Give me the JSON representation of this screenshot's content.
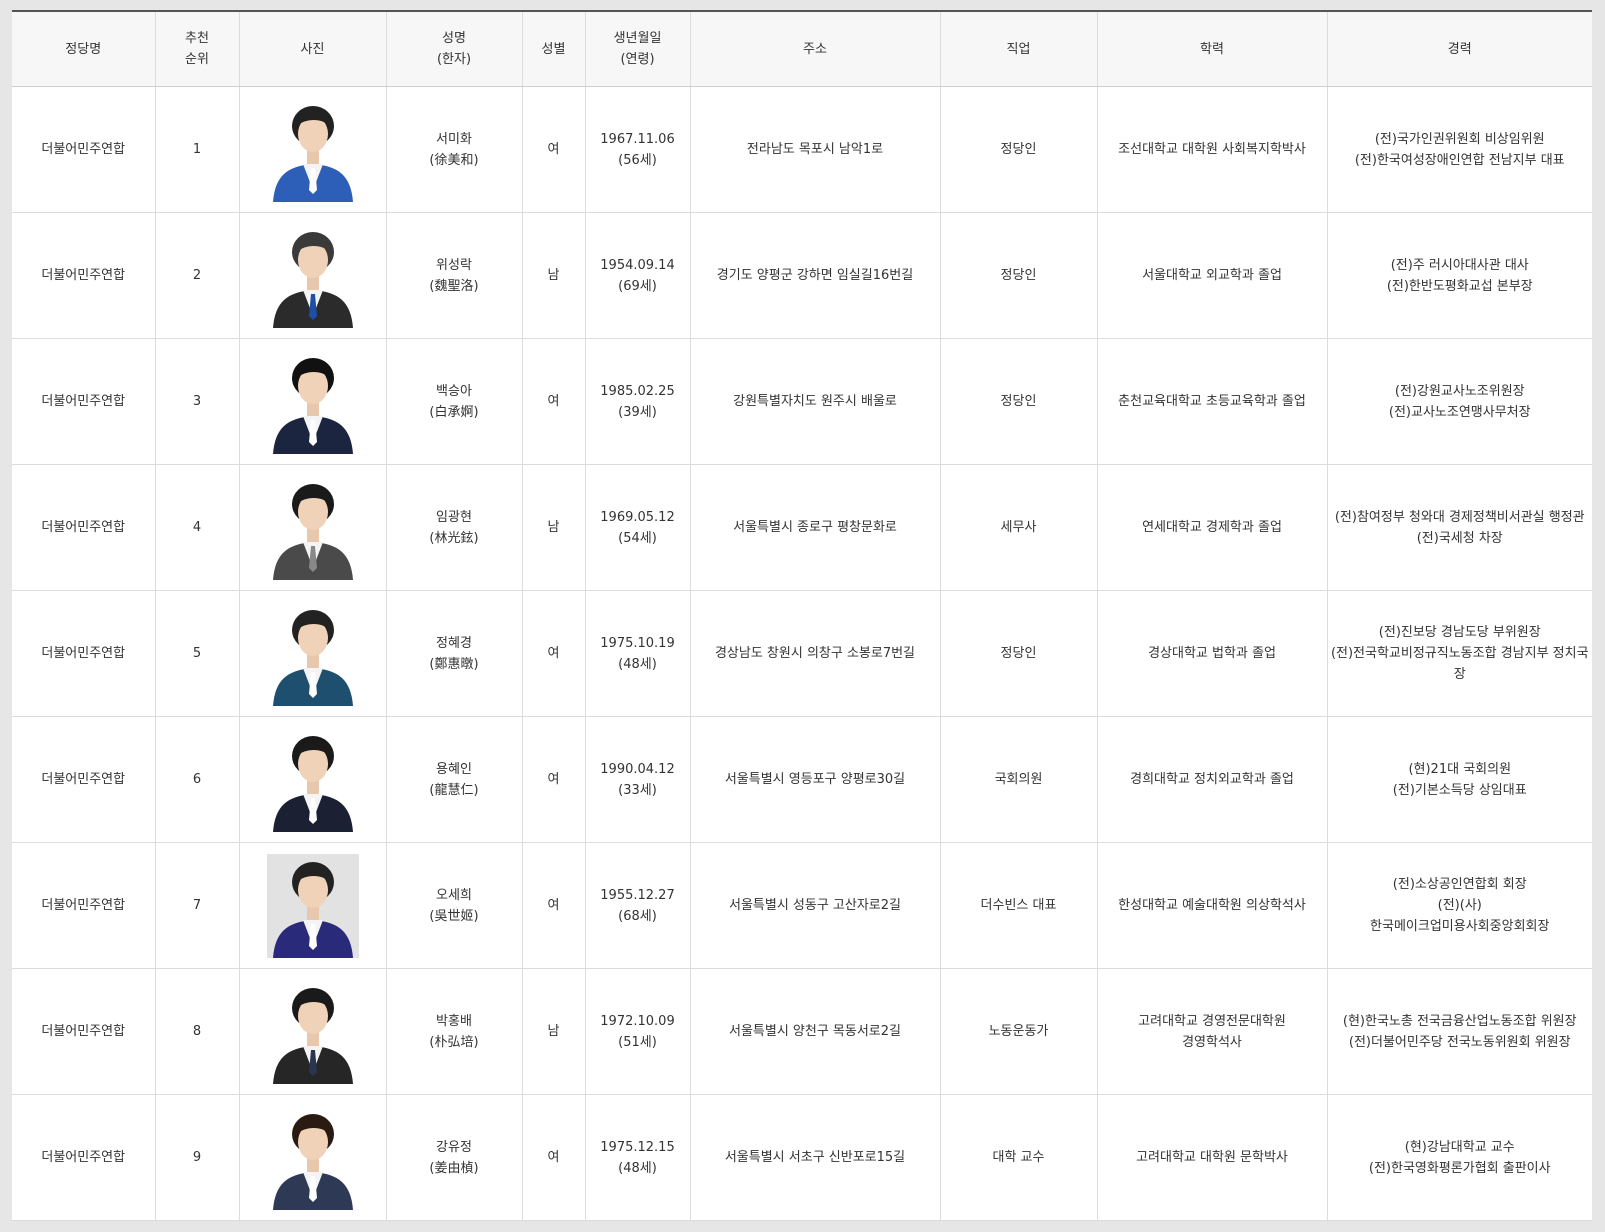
{
  "headers": {
    "party": "정당명",
    "rank_l1": "추천",
    "rank_l2": "순위",
    "photo": "사진",
    "name_l1": "성명",
    "name_l2": "(한자)",
    "gender": "성별",
    "birth_l1": "생년월일",
    "birth_l2": "(연령)",
    "address": "주소",
    "job": "직업",
    "education": "학력",
    "career": "경력"
  },
  "rows": [
    {
      "party": "더불어민주연합",
      "rank": "1",
      "name": "서미화",
      "hanja": "(徐美和)",
      "gender": "여",
      "birth": "1967.11.06",
      "age": "(56세)",
      "address": "전라남도 목포시 남악1로",
      "job": "정당인",
      "education": [
        "조선대학교 대학원 사회복지학박사"
      ],
      "career": [
        "(전)국가인권위원회 비상임위원",
        "(전)한국여성장애인연합 전남지부 대표"
      ],
      "photo": {
        "suit": "#2e5fb8",
        "bg": "#ffffff",
        "tie": "#ffffff",
        "hair": "#222222"
      }
    },
    {
      "party": "더불어민주연합",
      "rank": "2",
      "name": "위성락",
      "hanja": "(魏聖洛)",
      "gender": "남",
      "birth": "1954.09.14",
      "age": "(69세)",
      "address": "경기도 양평군 강하면 임실길16번길",
      "job": "정당인",
      "education": [
        "서울대학교 외교학과 졸업"
      ],
      "career": [
        "(전)주 러시아대사관 대사",
        "(전)한반도평화교섭 본부장"
      ],
      "photo": {
        "suit": "#2b2b2b",
        "bg": "#ffffff",
        "tie": "#1d4fa8",
        "hair": "#3a3a3a"
      }
    },
    {
      "party": "더불어민주연합",
      "rank": "3",
      "name": "백승아",
      "hanja": "(白承婀)",
      "gender": "여",
      "birth": "1985.02.25",
      "age": "(39세)",
      "address": "강원특별자치도 원주시 배울로",
      "job": "정당인",
      "education": [
        "춘천교육대학교 초등교육학과 졸업"
      ],
      "career": [
        "(전)강원교사노조위원장",
        "(전)교사노조연맹사무처장"
      ],
      "photo": {
        "suit": "#1c2540",
        "bg": "#ffffff",
        "tie": "#ffffff",
        "hair": "#111111"
      }
    },
    {
      "party": "더불어민주연합",
      "rank": "4",
      "name": "임광현",
      "hanja": "(林光鉉)",
      "gender": "남",
      "birth": "1969.05.12",
      "age": "(54세)",
      "address": "서울특별시 종로구 평창문화로",
      "job": "세무사",
      "education": [
        "연세대학교 경제학과 졸업"
      ],
      "career": [
        "(전)참여정부 청와대 경제정책비서관실 행정관",
        "(전)국세청 차장"
      ],
      "photo": {
        "suit": "#4a4a4a",
        "bg": "#ffffff",
        "tie": "#888888",
        "hair": "#1a1a1a"
      }
    },
    {
      "party": "더불어민주연합",
      "rank": "5",
      "name": "정혜경",
      "hanja": "(鄭惠暾)",
      "gender": "여",
      "birth": "1975.10.19",
      "age": "(48세)",
      "address": "경상남도 창원시 의창구 소봉로7번길",
      "job": "정당인",
      "education": [
        "경상대학교 법학과 졸업"
      ],
      "career": [
        "(전)진보당 경남도당 부위원장",
        "(전)전국학교비정규직노동조합 경남지부 정치국장"
      ],
      "photo": {
        "suit": "#1f4f6e",
        "bg": "#ffffff",
        "tie": "#ffffff",
        "hair": "#222222"
      }
    },
    {
      "party": "더불어민주연합",
      "rank": "6",
      "name": "용혜인",
      "hanja": "(龍慧仁)",
      "gender": "여",
      "birth": "1990.04.12",
      "age": "(33세)",
      "address": "서울특별시 영등포구 양평로30길",
      "job": "국회의원",
      "education": [
        "경희대학교 정치외교학과 졸업"
      ],
      "career": [
        "(현)21대 국회의원",
        "(전)기본소득당 상임대표"
      ],
      "photo": {
        "suit": "#1b2133",
        "bg": "#ffffff",
        "tie": "#ffffff",
        "hair": "#1a1a1a"
      }
    },
    {
      "party": "더불어민주연합",
      "rank": "7",
      "name": "오세희",
      "hanja": "(吳世姬)",
      "gender": "여",
      "birth": "1955.12.27",
      "age": "(68세)",
      "address": "서울특별시 성동구 고산자로2길",
      "job": "더수빈스 대표",
      "education": [
        "한성대학교 예술대학원 의상학석사"
      ],
      "career": [
        "(전)소상공인연합회 회장",
        "(전)(사)",
        "한국메이크업미용사회중앙회회장"
      ],
      "photo": {
        "suit": "#2a2a7a",
        "bg": "#e2e2e2",
        "tie": "#ffffff",
        "hair": "#222222"
      }
    },
    {
      "party": "더불어민주연합",
      "rank": "8",
      "name": "박홍배",
      "hanja": "(朴弘培)",
      "gender": "남",
      "birth": "1972.10.09",
      "age": "(51세)",
      "address": "서울특별시 양천구 목동서로2길",
      "job": "노동운동가",
      "education": [
        "고려대학교 경영전문대학원",
        "경영학석사"
      ],
      "career": [
        "(현)한국노총 전국금융산업노동조합 위원장",
        "(전)더불어민주당 전국노동위원회 위원장"
      ],
      "photo": {
        "suit": "#262626",
        "bg": "#ffffff",
        "tie": "#2a3552",
        "hair": "#1a1a1a"
      }
    },
    {
      "party": "더불어민주연합",
      "rank": "9",
      "name": "강유정",
      "hanja": "(姜由楨)",
      "gender": "여",
      "birth": "1975.12.15",
      "age": "(48세)",
      "address": "서울특별시 서초구 신반포로15길",
      "job": "대학 교수",
      "education": [
        "고려대학교 대학원 문학박사"
      ],
      "career": [
        "(현)강남대학교 교수",
        "(전)한국영화평론가협회 출판이사"
      ],
      "photo": {
        "suit": "#2e3a55",
        "bg": "#ffffff",
        "tie": "#ffffff",
        "hair": "#2a1a12"
      }
    }
  ]
}
